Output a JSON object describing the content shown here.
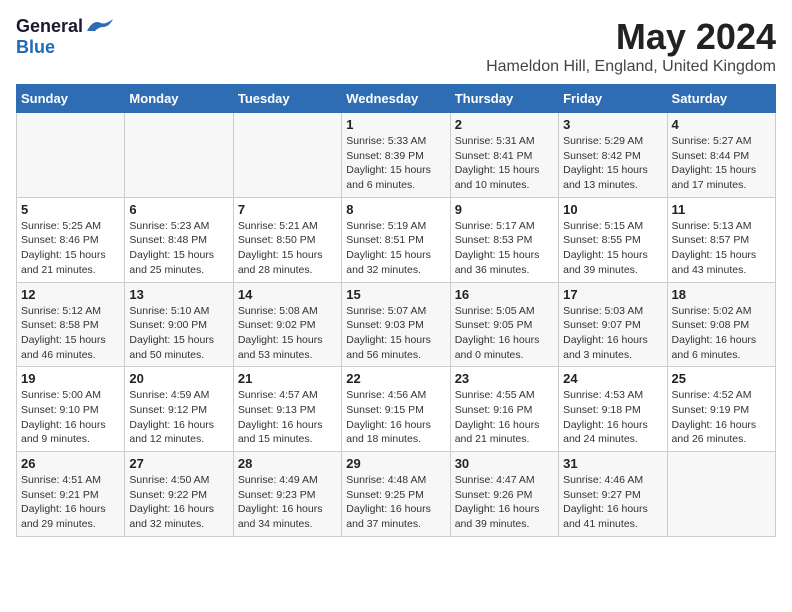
{
  "logo": {
    "general": "General",
    "blue": "Blue"
  },
  "title": "May 2024",
  "subtitle": "Hameldon Hill, England, United Kingdom",
  "days_of_week": [
    "Sunday",
    "Monday",
    "Tuesday",
    "Wednesday",
    "Thursday",
    "Friday",
    "Saturday"
  ],
  "weeks": [
    [
      {
        "day": "",
        "info": ""
      },
      {
        "day": "",
        "info": ""
      },
      {
        "day": "",
        "info": ""
      },
      {
        "day": "1",
        "info": "Sunrise: 5:33 AM\nSunset: 8:39 PM\nDaylight: 15 hours\nand 6 minutes."
      },
      {
        "day": "2",
        "info": "Sunrise: 5:31 AM\nSunset: 8:41 PM\nDaylight: 15 hours\nand 10 minutes."
      },
      {
        "day": "3",
        "info": "Sunrise: 5:29 AM\nSunset: 8:42 PM\nDaylight: 15 hours\nand 13 minutes."
      },
      {
        "day": "4",
        "info": "Sunrise: 5:27 AM\nSunset: 8:44 PM\nDaylight: 15 hours\nand 17 minutes."
      }
    ],
    [
      {
        "day": "5",
        "info": "Sunrise: 5:25 AM\nSunset: 8:46 PM\nDaylight: 15 hours\nand 21 minutes."
      },
      {
        "day": "6",
        "info": "Sunrise: 5:23 AM\nSunset: 8:48 PM\nDaylight: 15 hours\nand 25 minutes."
      },
      {
        "day": "7",
        "info": "Sunrise: 5:21 AM\nSunset: 8:50 PM\nDaylight: 15 hours\nand 28 minutes."
      },
      {
        "day": "8",
        "info": "Sunrise: 5:19 AM\nSunset: 8:51 PM\nDaylight: 15 hours\nand 32 minutes."
      },
      {
        "day": "9",
        "info": "Sunrise: 5:17 AM\nSunset: 8:53 PM\nDaylight: 15 hours\nand 36 minutes."
      },
      {
        "day": "10",
        "info": "Sunrise: 5:15 AM\nSunset: 8:55 PM\nDaylight: 15 hours\nand 39 minutes."
      },
      {
        "day": "11",
        "info": "Sunrise: 5:13 AM\nSunset: 8:57 PM\nDaylight: 15 hours\nand 43 minutes."
      }
    ],
    [
      {
        "day": "12",
        "info": "Sunrise: 5:12 AM\nSunset: 8:58 PM\nDaylight: 15 hours\nand 46 minutes."
      },
      {
        "day": "13",
        "info": "Sunrise: 5:10 AM\nSunset: 9:00 PM\nDaylight: 15 hours\nand 50 minutes."
      },
      {
        "day": "14",
        "info": "Sunrise: 5:08 AM\nSunset: 9:02 PM\nDaylight: 15 hours\nand 53 minutes."
      },
      {
        "day": "15",
        "info": "Sunrise: 5:07 AM\nSunset: 9:03 PM\nDaylight: 15 hours\nand 56 minutes."
      },
      {
        "day": "16",
        "info": "Sunrise: 5:05 AM\nSunset: 9:05 PM\nDaylight: 16 hours\nand 0 minutes."
      },
      {
        "day": "17",
        "info": "Sunrise: 5:03 AM\nSunset: 9:07 PM\nDaylight: 16 hours\nand 3 minutes."
      },
      {
        "day": "18",
        "info": "Sunrise: 5:02 AM\nSunset: 9:08 PM\nDaylight: 16 hours\nand 6 minutes."
      }
    ],
    [
      {
        "day": "19",
        "info": "Sunrise: 5:00 AM\nSunset: 9:10 PM\nDaylight: 16 hours\nand 9 minutes."
      },
      {
        "day": "20",
        "info": "Sunrise: 4:59 AM\nSunset: 9:12 PM\nDaylight: 16 hours\nand 12 minutes."
      },
      {
        "day": "21",
        "info": "Sunrise: 4:57 AM\nSunset: 9:13 PM\nDaylight: 16 hours\nand 15 minutes."
      },
      {
        "day": "22",
        "info": "Sunrise: 4:56 AM\nSunset: 9:15 PM\nDaylight: 16 hours\nand 18 minutes."
      },
      {
        "day": "23",
        "info": "Sunrise: 4:55 AM\nSunset: 9:16 PM\nDaylight: 16 hours\nand 21 minutes."
      },
      {
        "day": "24",
        "info": "Sunrise: 4:53 AM\nSunset: 9:18 PM\nDaylight: 16 hours\nand 24 minutes."
      },
      {
        "day": "25",
        "info": "Sunrise: 4:52 AM\nSunset: 9:19 PM\nDaylight: 16 hours\nand 26 minutes."
      }
    ],
    [
      {
        "day": "26",
        "info": "Sunrise: 4:51 AM\nSunset: 9:21 PM\nDaylight: 16 hours\nand 29 minutes."
      },
      {
        "day": "27",
        "info": "Sunrise: 4:50 AM\nSunset: 9:22 PM\nDaylight: 16 hours\nand 32 minutes."
      },
      {
        "day": "28",
        "info": "Sunrise: 4:49 AM\nSunset: 9:23 PM\nDaylight: 16 hours\nand 34 minutes."
      },
      {
        "day": "29",
        "info": "Sunrise: 4:48 AM\nSunset: 9:25 PM\nDaylight: 16 hours\nand 37 minutes."
      },
      {
        "day": "30",
        "info": "Sunrise: 4:47 AM\nSunset: 9:26 PM\nDaylight: 16 hours\nand 39 minutes."
      },
      {
        "day": "31",
        "info": "Sunrise: 4:46 AM\nSunset: 9:27 PM\nDaylight: 16 hours\nand 41 minutes."
      },
      {
        "day": "",
        "info": ""
      }
    ]
  ]
}
